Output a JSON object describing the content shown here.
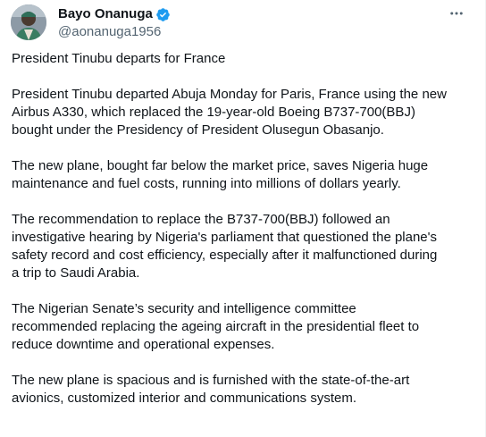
{
  "author": {
    "display_name": "Bayo Onanuga",
    "handle": "@aonanuga1956",
    "verified": true,
    "verified_color": "#1d9bf0"
  },
  "icons": {
    "more": "more-horizontal-icon",
    "verified": "verified-badge-icon"
  },
  "post": {
    "paragraphs": [
      "President Tinubu departs  for  France",
      "President Tinubu departed Abuja Monday for Paris, France using the new\nAirbus A330, which replaced the 19-year-old Boeing  B737-700(BBJ)\nbought under the Presidency of President Olusegun Obasanjo.",
      "The new plane, bought far below the market price, saves Nigeria huge\nmaintenance and fuel costs, running into millions of dollars yearly.",
      "The recommendation to replace the B737-700(BBJ) followed an\ninvestigative hearing by Nigeria's parliament that questioned the plane's\nsafety record and cost efficiency, especially after it malfunctioned during\na trip to Saudi Arabia.",
      "The Nigerian Senate’s security and intelligence committee\nrecommended replacing the ageing aircraft in the presidential fleet to\nreduce downtime and operational expenses.",
      "The new plane is spacious and  is furnished with the  state-of-the-art\navionics, customized interior and communications system."
    ]
  }
}
